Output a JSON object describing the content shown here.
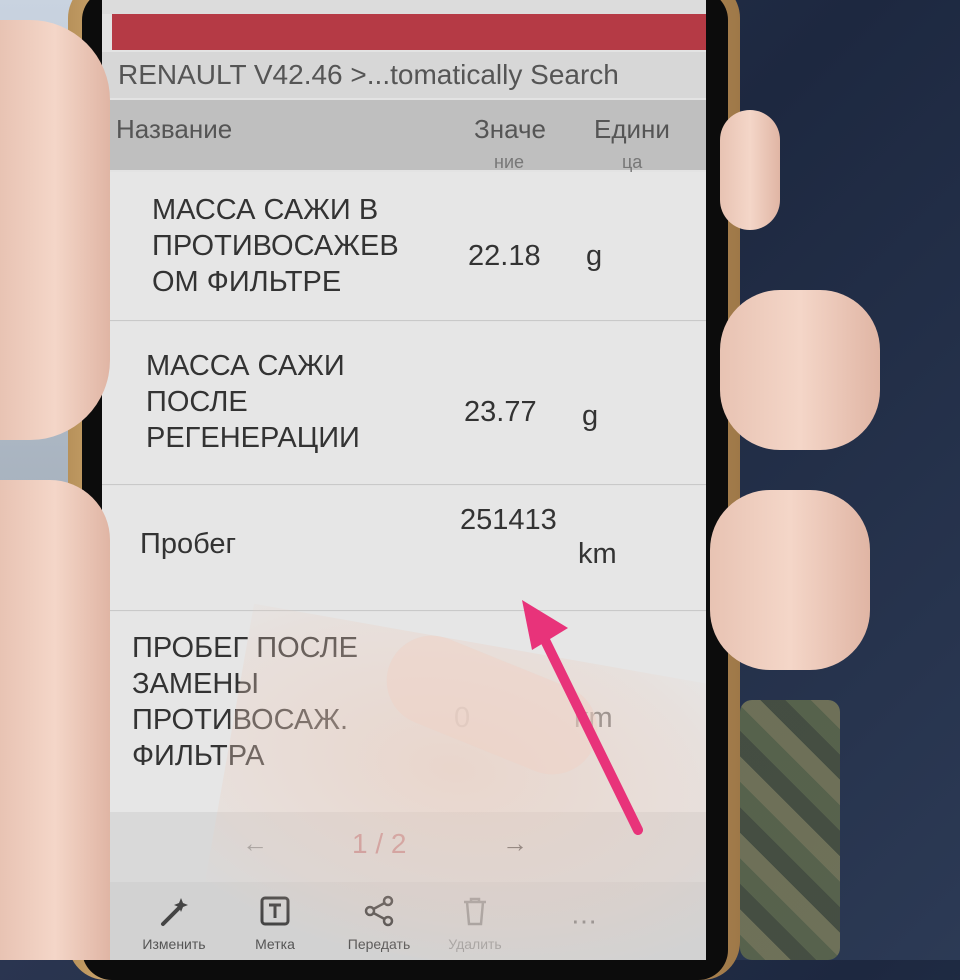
{
  "app": {
    "title": "RENAULT V42.46 >...tomatically Search"
  },
  "table": {
    "headers": {
      "name": "Название",
      "value": "Значе",
      "unit": "Едини",
      "value_cont": "ние",
      "unit_cont": "ца"
    },
    "rows": [
      {
        "name": "МАССА САЖИ В ПРОТИВОСАЖЕВ ОМ ФИЛЬТРЕ",
        "value": "22.18",
        "unit": "g"
      },
      {
        "name": "МАССА САЖИ ПОСЛЕ РЕГЕНЕРАЦИИ",
        "value": "23.77",
        "unit": "g"
      },
      {
        "name": "Пробег",
        "value": "251413",
        "unit": "km"
      },
      {
        "name": "ПРОБЕГ ПОСЛЕ ЗАМЕНЫ ПРОТИВОСАЖ. ФИЛЬТРА",
        "value": "0",
        "unit": "km"
      }
    ]
  },
  "pager": {
    "prev": "←",
    "page": "1 / 2",
    "next": "→"
  },
  "toolbar": {
    "items": [
      {
        "label": "Изменить",
        "icon": "magic-wand-icon"
      },
      {
        "label": "Метка",
        "icon": "text-tag-icon"
      },
      {
        "label": "Передать",
        "icon": "share-icon"
      },
      {
        "label": "Удалить",
        "icon": "trash-icon"
      }
    ],
    "more": "⋯"
  },
  "colors": {
    "accent_red": "#b53a45",
    "annotation_arrow": "#e8337a"
  }
}
